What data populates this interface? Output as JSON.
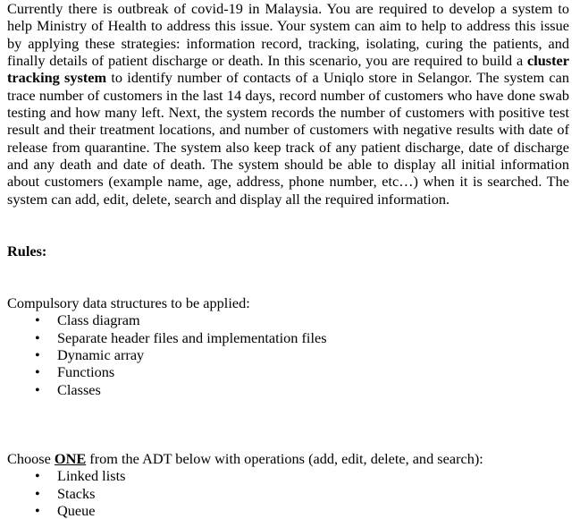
{
  "document": {
    "intro_paragraph": {
      "segments": [
        {
          "text": "Currently there is outbreak of covid-19 in Malaysia. You are required to develop a system to help Ministry of Health to address this issue. Your system can aim to help to address this issue by applying these strategies: information record, tracking, isolating, curing the patients, and finally details of patient discharge or death. In this scenario, you are required to build a ",
          "style": "normal"
        },
        {
          "text": "cluster tracking system",
          "style": "bold"
        },
        {
          "text": " to identify number of contacts of a Uniqlo store in Selangor. The system can trace number of customers in the last 14 days, record number of customers who have done swab testing and how many left. Next, the system records the number of customers with positive test result and their treatment locations, and number of customers with negative results with date of release from quarantine. The system also keep track of any patient discharge, date of discharge and any death and date of death. The system should be able to display all initial information about customers (example name, age, address, phone number, etc…) when it is searched. The system can add, edit, delete, search and display all the required information.",
          "style": "normal"
        }
      ]
    },
    "rules_heading": "Rules:",
    "compulsory_intro": "Compulsory data structures to be applied:",
    "compulsory_items": [
      "Class diagram",
      "Separate header files and implementation files",
      "Dynamic array",
      "Functions",
      "Classes"
    ],
    "adt_line": {
      "segments": [
        {
          "text": "Choose ",
          "style": "normal"
        },
        {
          "text": "ONE",
          "style": "bold-underline"
        },
        {
          "text": " from the ADT below with operations (add, edit, delete, and search):",
          "style": "normal"
        }
      ]
    },
    "adt_items": [
      "Linked lists",
      "Stacks",
      "Queue"
    ],
    "bullet_glyph": "•",
    "colors": {
      "page_background": "#ffffff",
      "text": "#000000"
    }
  }
}
